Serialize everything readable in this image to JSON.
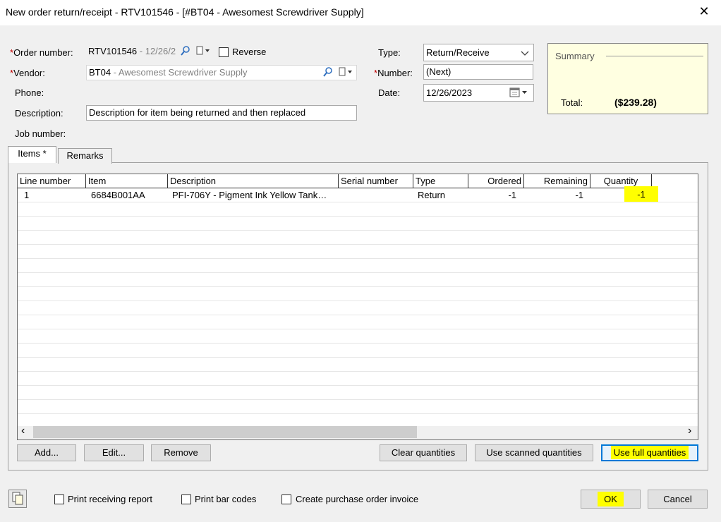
{
  "window": {
    "title": "New order return/receipt - RTV101546 - [#BT04 - Awesomest Screwdriver Supply]",
    "close_glyph": "✕"
  },
  "form": {
    "order_number_label": "Order number:",
    "order_number_value": "RTV101546",
    "order_number_suffix": " - 12/26/2",
    "reverse_label": "Reverse",
    "vendor_label": "Vendor:",
    "vendor_value": "BT04",
    "vendor_suffix": " - Awesomest Screwdriver Supply",
    "phone_label": "Phone:",
    "description_label": "Description:",
    "description_value": "Description for item being returned and then replaced",
    "job_number_label": "Job number:",
    "type_label": "Type:",
    "type_value": "Return/Receive",
    "number_label": "Number:",
    "number_value": "(Next)",
    "date_label": "Date:",
    "date_value": "12/26/2023",
    "required_mark": "*"
  },
  "summary": {
    "title": "Summary",
    "total_label": "Total:",
    "total_value": "($239.28)"
  },
  "tabs": [
    {
      "label": "Items *"
    },
    {
      "label": "Remarks"
    }
  ],
  "grid": {
    "columns": [
      "Line number",
      "Item",
      "Description",
      "Serial number",
      "Type",
      "Ordered",
      "Remaining",
      "Quantity"
    ],
    "rows": [
      {
        "line": "1",
        "item": "6684B001AA",
        "description": "PFI-706Y - Pigment Ink Yellow Tank…",
        "serial": "",
        "type": "Return",
        "ordered": "-1",
        "remaining": "-1",
        "quantity": "-1"
      }
    ],
    "scroll_left": "‹",
    "scroll_right": "›"
  },
  "buttons": {
    "add": "Add...",
    "edit": "Edit...",
    "remove": "Remove",
    "clear": "Clear quantities",
    "scanned": "Use scanned quantities",
    "full": "Use full quantities",
    "ok": "OK",
    "cancel": "Cancel"
  },
  "footer": {
    "print_receiving": "Print receiving report",
    "print_barcodes": "Print bar codes",
    "create_invoice": "Create purchase order invoice"
  },
  "colors": {
    "highlight": "#ffff00",
    "summary_bg": "#ffffe1",
    "required": "#c00000"
  }
}
